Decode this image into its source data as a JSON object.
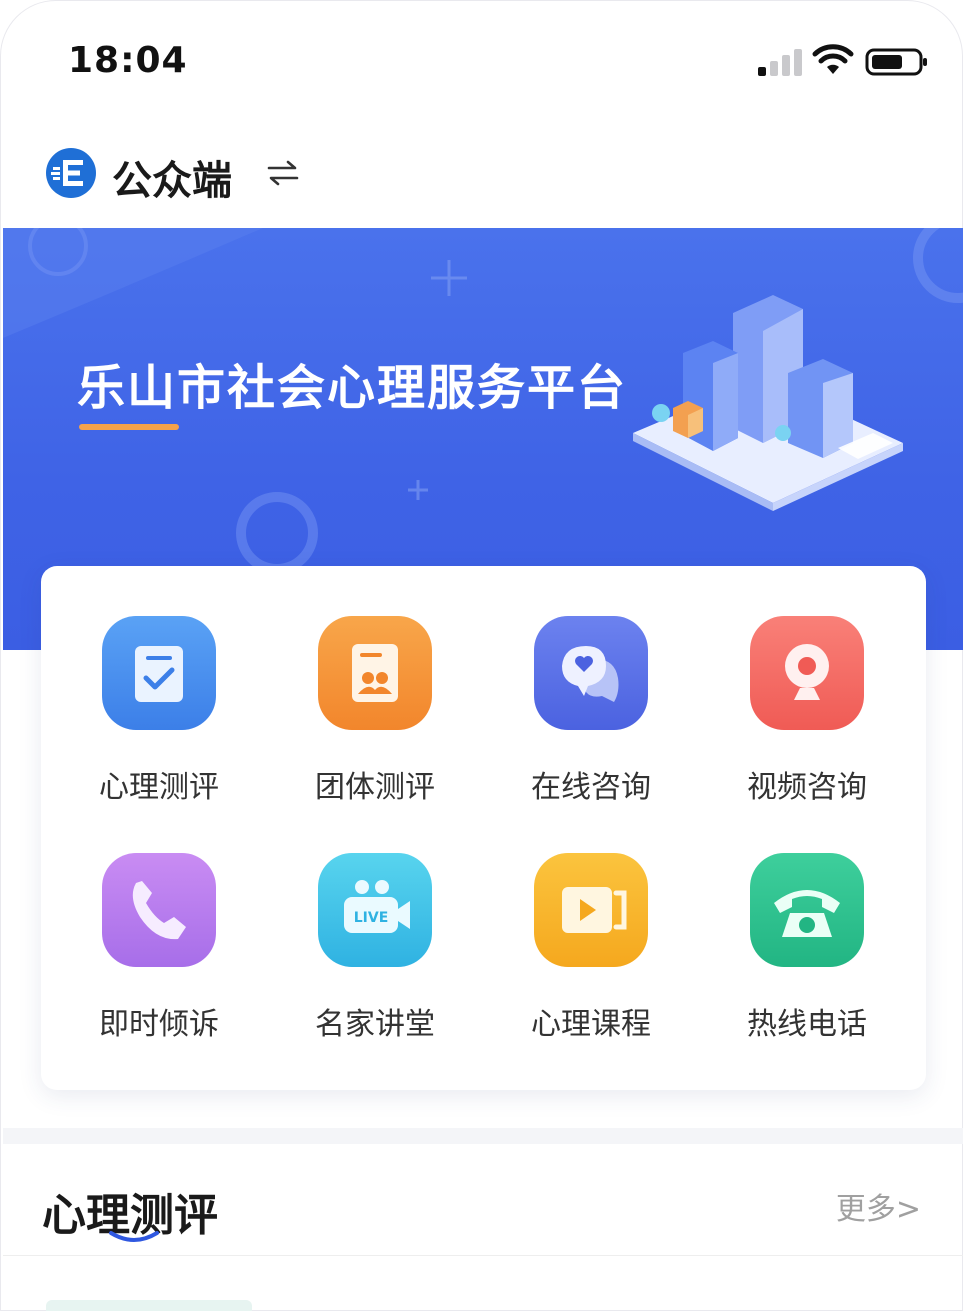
{
  "status_bar": {
    "time": "18:04"
  },
  "header": {
    "title": "公众端"
  },
  "banner": {
    "title": "乐山市社会心理服务平台"
  },
  "services": [
    {
      "label": "心理测评",
      "icon": "assessment-clipboard-icon",
      "color": "#4b8ff0"
    },
    {
      "label": "团体测评",
      "icon": "group-report-icon",
      "color": "#f5933a"
    },
    {
      "label": "在线咨询",
      "icon": "chat-bubble-heart-icon",
      "color": "#5a6fe6"
    },
    {
      "label": "视频咨询",
      "icon": "webcam-icon",
      "color": "#f56b63"
    },
    {
      "label": "即时倾诉",
      "icon": "phone-handset-icon",
      "color": "#b77ef0"
    },
    {
      "label": "名家讲堂",
      "icon": "live-camera-icon",
      "color": "#3fc4e8"
    },
    {
      "label": "心理课程",
      "icon": "video-play-icon",
      "color": "#f7b52c"
    },
    {
      "label": "热线电话",
      "icon": "telephone-icon",
      "color": "#2fc08f"
    }
  ],
  "section": {
    "title": "心理测评",
    "more": "更多>"
  }
}
